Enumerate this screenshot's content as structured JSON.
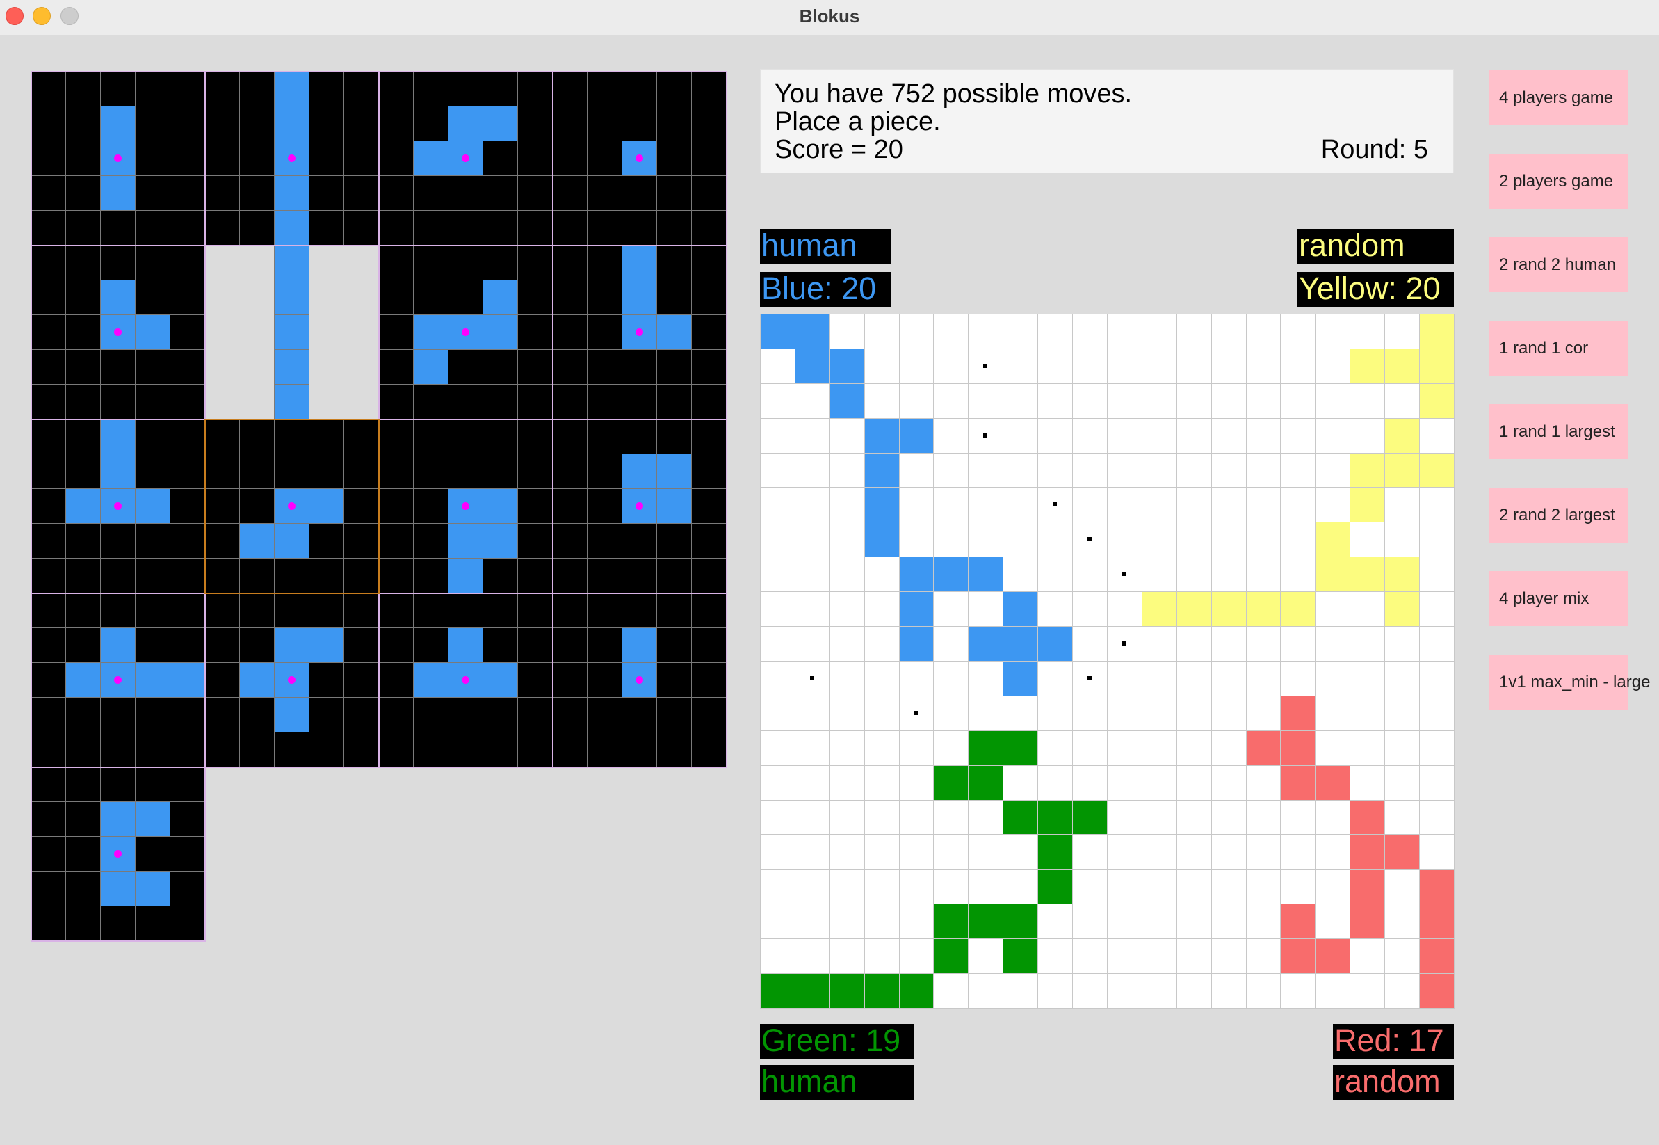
{
  "window": {
    "title": "Blokus"
  },
  "status": {
    "line1": "You have 752 possible moves.",
    "line2": "Place a piece.",
    "score": "Score = 20",
    "round": "Round: 5"
  },
  "players": {
    "blue": {
      "type": "human",
      "score_label": "Blue: 20"
    },
    "yellow": {
      "type": "random",
      "score_label": "Yellow: 20"
    },
    "green": {
      "type": "human",
      "score_label": "Green: 19"
    },
    "red": {
      "type": "random",
      "score_label": "Red: 17"
    }
  },
  "colors": {
    "blue": "#3d97f2",
    "yellow": "#fcfc7f",
    "green": "#029502",
    "red": "#f86c6c",
    "piece_dot": "#ff00ff",
    "panel_bg": "#000000",
    "button": "#ffc0cb"
  },
  "menu": {
    "buttons": [
      "4 players game",
      "2 players game",
      "2 rand 2 human",
      "1 rand 1 cor",
      "1 rand 1 largest",
      "2 rand 2 largest",
      "4 player mix",
      "1v1 max_min - large"
    ]
  },
  "board": {
    "size": 20,
    "blue": [
      [
        0,
        0
      ],
      [
        1,
        0
      ],
      [
        1,
        1
      ],
      [
        2,
        1
      ],
      [
        2,
        2
      ],
      [
        3,
        3
      ],
      [
        4,
        3
      ],
      [
        3,
        4
      ],
      [
        3,
        5
      ],
      [
        3,
        6
      ],
      [
        4,
        7
      ],
      [
        5,
        7
      ],
      [
        6,
        7
      ],
      [
        4,
        8
      ],
      [
        7,
        8
      ],
      [
        4,
        9
      ],
      [
        6,
        9
      ],
      [
        7,
        9
      ],
      [
        8,
        9
      ],
      [
        7,
        10
      ]
    ],
    "yellow": [
      [
        19,
        0
      ],
      [
        17,
        1
      ],
      [
        18,
        1
      ],
      [
        19,
        1
      ],
      [
        19,
        2
      ],
      [
        18,
        3
      ],
      [
        17,
        4
      ],
      [
        18,
        4
      ],
      [
        19,
        4
      ],
      [
        17,
        5
      ],
      [
        16,
        6
      ],
      [
        16,
        7
      ],
      [
        17,
        7
      ],
      [
        18,
        7
      ],
      [
        11,
        8
      ],
      [
        12,
        8
      ],
      [
        13,
        8
      ],
      [
        14,
        8
      ],
      [
        15,
        8
      ],
      [
        18,
        8
      ]
    ],
    "green": [
      [
        6,
        12
      ],
      [
        7,
        12
      ],
      [
        5,
        13
      ],
      [
        6,
        13
      ],
      [
        7,
        14
      ],
      [
        8,
        14
      ],
      [
        9,
        14
      ],
      [
        8,
        15
      ],
      [
        8,
        16
      ],
      [
        5,
        17
      ],
      [
        6,
        17
      ],
      [
        7,
        17
      ],
      [
        5,
        18
      ],
      [
        7,
        18
      ],
      [
        0,
        19
      ],
      [
        1,
        19
      ],
      [
        2,
        19
      ],
      [
        3,
        19
      ],
      [
        4,
        19
      ]
    ],
    "red": [
      [
        15,
        11
      ],
      [
        14,
        12
      ],
      [
        15,
        12
      ],
      [
        15,
        13
      ],
      [
        16,
        13
      ],
      [
        17,
        14
      ],
      [
        17,
        15
      ],
      [
        18,
        15
      ],
      [
        17,
        16
      ],
      [
        19,
        16
      ],
      [
        15,
        17
      ],
      [
        17,
        17
      ],
      [
        19,
        17
      ],
      [
        15,
        18
      ],
      [
        16,
        18
      ],
      [
        19,
        18
      ],
      [
        19,
        19
      ]
    ],
    "hints": [
      [
        6,
        1
      ],
      [
        6,
        3
      ],
      [
        8,
        5
      ],
      [
        9,
        6
      ],
      [
        10,
        7
      ],
      [
        10,
        9
      ],
      [
        1,
        10
      ],
      [
        9,
        10
      ],
      [
        4,
        11
      ]
    ]
  },
  "pieces": [
    {
      "block": [
        0,
        0
      ],
      "cells": [
        [
          2,
          1
        ],
        [
          2,
          2
        ],
        [
          2,
          3
        ]
      ],
      "pivot": [
        2,
        2
      ]
    },
    {
      "block": [
        1,
        0
      ],
      "cells": [
        [
          2,
          0
        ],
        [
          2,
          1
        ],
        [
          2,
          2
        ],
        [
          2,
          3
        ],
        [
          2,
          4
        ],
        [
          2,
          5
        ],
        [
          2,
          6
        ],
        [
          2,
          7
        ],
        [
          2,
          8
        ],
        [
          2,
          9
        ]
      ],
      "pivot": [
        2,
        2
      ]
    },
    {
      "block": [
        2,
        0
      ],
      "cells": [
        [
          2,
          1
        ],
        [
          3,
          1
        ],
        [
          1,
          2
        ],
        [
          2,
          2
        ]
      ],
      "pivot": [
        2,
        2
      ]
    },
    {
      "block": [
        3,
        0
      ],
      "cells": [
        [
          2,
          2
        ]
      ],
      "pivot": [
        2,
        2
      ]
    },
    {
      "block": [
        0,
        1
      ],
      "cells": [
        [
          2,
          1
        ],
        [
          2,
          2
        ],
        [
          3,
          2
        ]
      ],
      "pivot": [
        2,
        2
      ]
    },
    {
      "block": [
        2,
        1
      ],
      "cells": [
        [
          3,
          1
        ],
        [
          1,
          2
        ],
        [
          2,
          2
        ],
        [
          3,
          2
        ],
        [
          1,
          3
        ]
      ],
      "pivot": [
        2,
        2
      ]
    },
    {
      "block": [
        3,
        1
      ],
      "cells": [
        [
          2,
          0
        ],
        [
          2,
          1
        ],
        [
          2,
          2
        ],
        [
          3,
          2
        ]
      ],
      "pivot": [
        2,
        2
      ]
    },
    {
      "block": [
        0,
        2
      ],
      "cells": [
        [
          2,
          0
        ],
        [
          2,
          1
        ],
        [
          1,
          2
        ],
        [
          2,
          2
        ],
        [
          3,
          2
        ]
      ],
      "pivot": [
        2,
        2
      ]
    },
    {
      "block": [
        1,
        2
      ],
      "cells": [
        [
          2,
          2
        ],
        [
          3,
          2
        ],
        [
          1,
          3
        ],
        [
          2,
          3
        ]
      ],
      "pivot": [
        2,
        2
      ]
    },
    {
      "block": [
        2,
        2
      ],
      "cells": [
        [
          2,
          2
        ],
        [
          3,
          2
        ],
        [
          2,
          3
        ],
        [
          3,
          3
        ],
        [
          2,
          4
        ]
      ],
      "pivot": [
        2,
        2
      ]
    },
    {
      "block": [
        3,
        2
      ],
      "cells": [
        [
          2,
          1
        ],
        [
          3,
          1
        ],
        [
          2,
          2
        ],
        [
          3,
          2
        ]
      ],
      "pivot": [
        2,
        2
      ]
    },
    {
      "block": [
        0,
        3
      ],
      "cells": [
        [
          2,
          1
        ],
        [
          1,
          2
        ],
        [
          2,
          2
        ],
        [
          3,
          2
        ],
        [
          4,
          2
        ]
      ],
      "pivot": [
        2,
        2
      ]
    },
    {
      "block": [
        1,
        3
      ],
      "cells": [
        [
          2,
          1
        ],
        [
          3,
          1
        ],
        [
          1,
          2
        ],
        [
          2,
          2
        ],
        [
          2,
          3
        ]
      ],
      "pivot": [
        2,
        2
      ]
    },
    {
      "block": [
        2,
        3
      ],
      "cells": [
        [
          2,
          1
        ],
        [
          1,
          2
        ],
        [
          2,
          2
        ],
        [
          3,
          2
        ]
      ],
      "pivot": [
        2,
        2
      ]
    },
    {
      "block": [
        3,
        3
      ],
      "cells": [
        [
          2,
          1
        ],
        [
          2,
          2
        ]
      ],
      "pivot": [
        2,
        2
      ]
    },
    {
      "block": [
        0,
        4
      ],
      "cells": [
        [
          2,
          1
        ],
        [
          3,
          1
        ],
        [
          2,
          2
        ],
        [
          2,
          3
        ],
        [
          3,
          3
        ]
      ],
      "pivot": [
        2,
        2
      ]
    }
  ],
  "selected_piece": [
    1,
    2
  ]
}
